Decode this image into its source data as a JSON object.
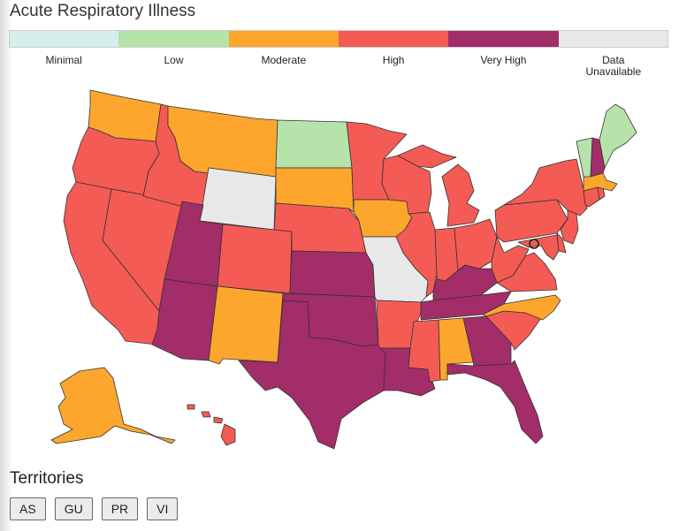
{
  "title": "Acute Respiratory Illness",
  "legend": [
    {
      "label": "Minimal",
      "color": "#d5efeb"
    },
    {
      "label": "Low",
      "color": "#b6e3aa"
    },
    {
      "label": "Moderate",
      "color": "#fca62d"
    },
    {
      "label": "High",
      "color": "#f45b54"
    },
    {
      "label": "Very High",
      "color": "#a22d68"
    },
    {
      "label": "Data\nUnavailable",
      "color": "#e8e8e8"
    }
  ],
  "levels": {
    "Minimal": "#d5efeb",
    "Low": "#b6e3aa",
    "Moderate": "#fca62d",
    "High": "#f45b54",
    "Very High": "#a22d68",
    "Data Unavailable": "#e8e8e8"
  },
  "states": {
    "WA": "Moderate",
    "OR": "High",
    "CA": "High",
    "NV": "High",
    "ID": "High",
    "MT": "Moderate",
    "WY": "Data Unavailable",
    "UT": "Very High",
    "AZ": "Very High",
    "CO": "High",
    "NM": "Moderate",
    "ND": "Low",
    "SD": "Moderate",
    "NE": "High",
    "KS": "Very High",
    "OK": "Very High",
    "TX": "Very High",
    "MN": "High",
    "IA": "Moderate",
    "MO": "Data Unavailable",
    "AR": "High",
    "LA": "Very High",
    "WI": "High",
    "IL": "High",
    "MI": "High",
    "IN": "High",
    "OH": "High",
    "KY": "Very High",
    "TN": "Very High",
    "MS": "High",
    "AL": "Moderate",
    "GA": "Very High",
    "FL": "Very High",
    "SC": "High",
    "NC": "Moderate",
    "VA": "High",
    "WV": "High",
    "PA": "High",
    "NY": "High",
    "NJ": "High",
    "DE": "High",
    "MD": "High",
    "DC": "High",
    "CT": "High",
    "RI": "High",
    "MA": "Moderate",
    "VT": "Low",
    "NH": "Very High",
    "ME": "Low",
    "AK": "Moderate",
    "HI": "High"
  },
  "territories_title": "Territories",
  "territories": [
    "AS",
    "GU",
    "PR",
    "VI"
  ]
}
